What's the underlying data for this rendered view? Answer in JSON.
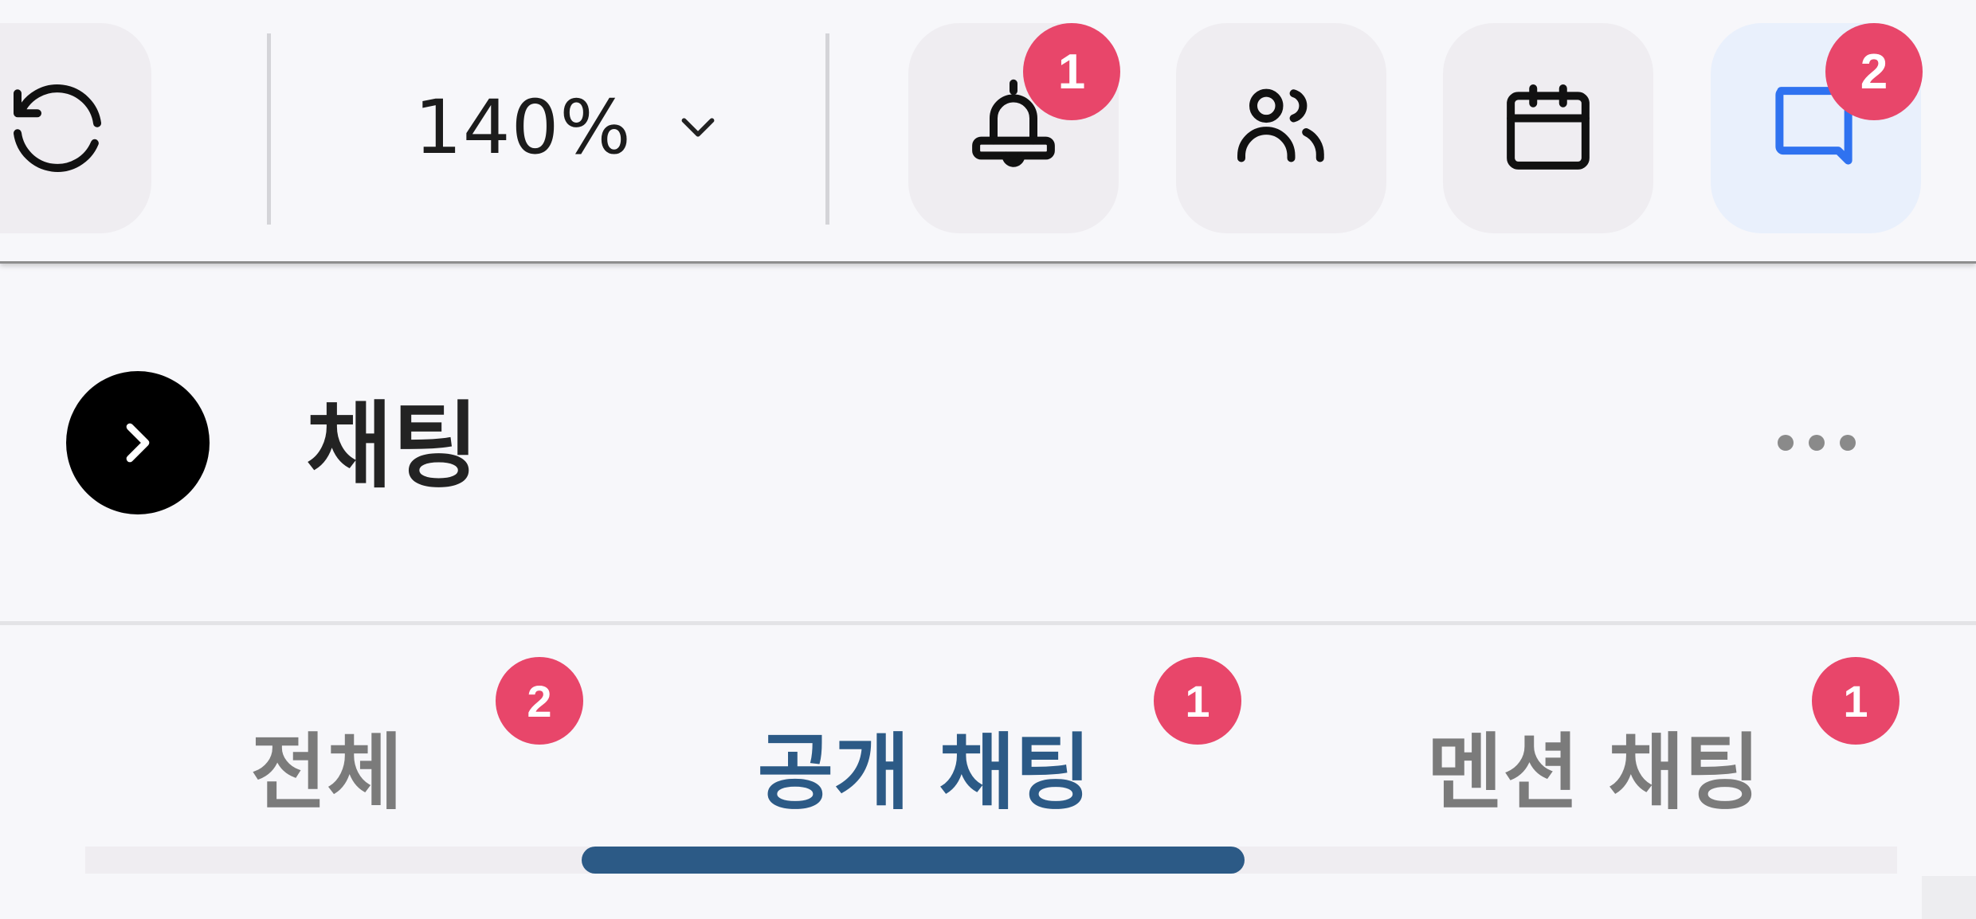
{
  "toolbar": {
    "zoom": {
      "value": "140%",
      "icon": "chevron-down-icon"
    },
    "buttons": [
      {
        "id": "refresh",
        "icon": "refresh-icon"
      },
      {
        "id": "notifications",
        "icon": "bell-icon",
        "badge": "1"
      },
      {
        "id": "users",
        "icon": "users-icon"
      },
      {
        "id": "calendar",
        "icon": "calendar-icon"
      },
      {
        "id": "chat",
        "icon": "chat-icon",
        "badge": "2",
        "active": true
      }
    ]
  },
  "header": {
    "title": "채팅",
    "collapse_icon": "chevron-right-icon",
    "more_icon": "more-horizontal-icon"
  },
  "tabs": [
    {
      "label": "전체",
      "badge": "2",
      "active": false
    },
    {
      "label": "공개 채팅",
      "badge": "1",
      "active": true
    },
    {
      "label": "멘션 채팅",
      "badge": "1",
      "active": false
    }
  ],
  "colors": {
    "badge": "#e8466a",
    "active_tab": "#2c5a86",
    "active_icon": "#2f72f0",
    "background": "#f7f7fa"
  }
}
